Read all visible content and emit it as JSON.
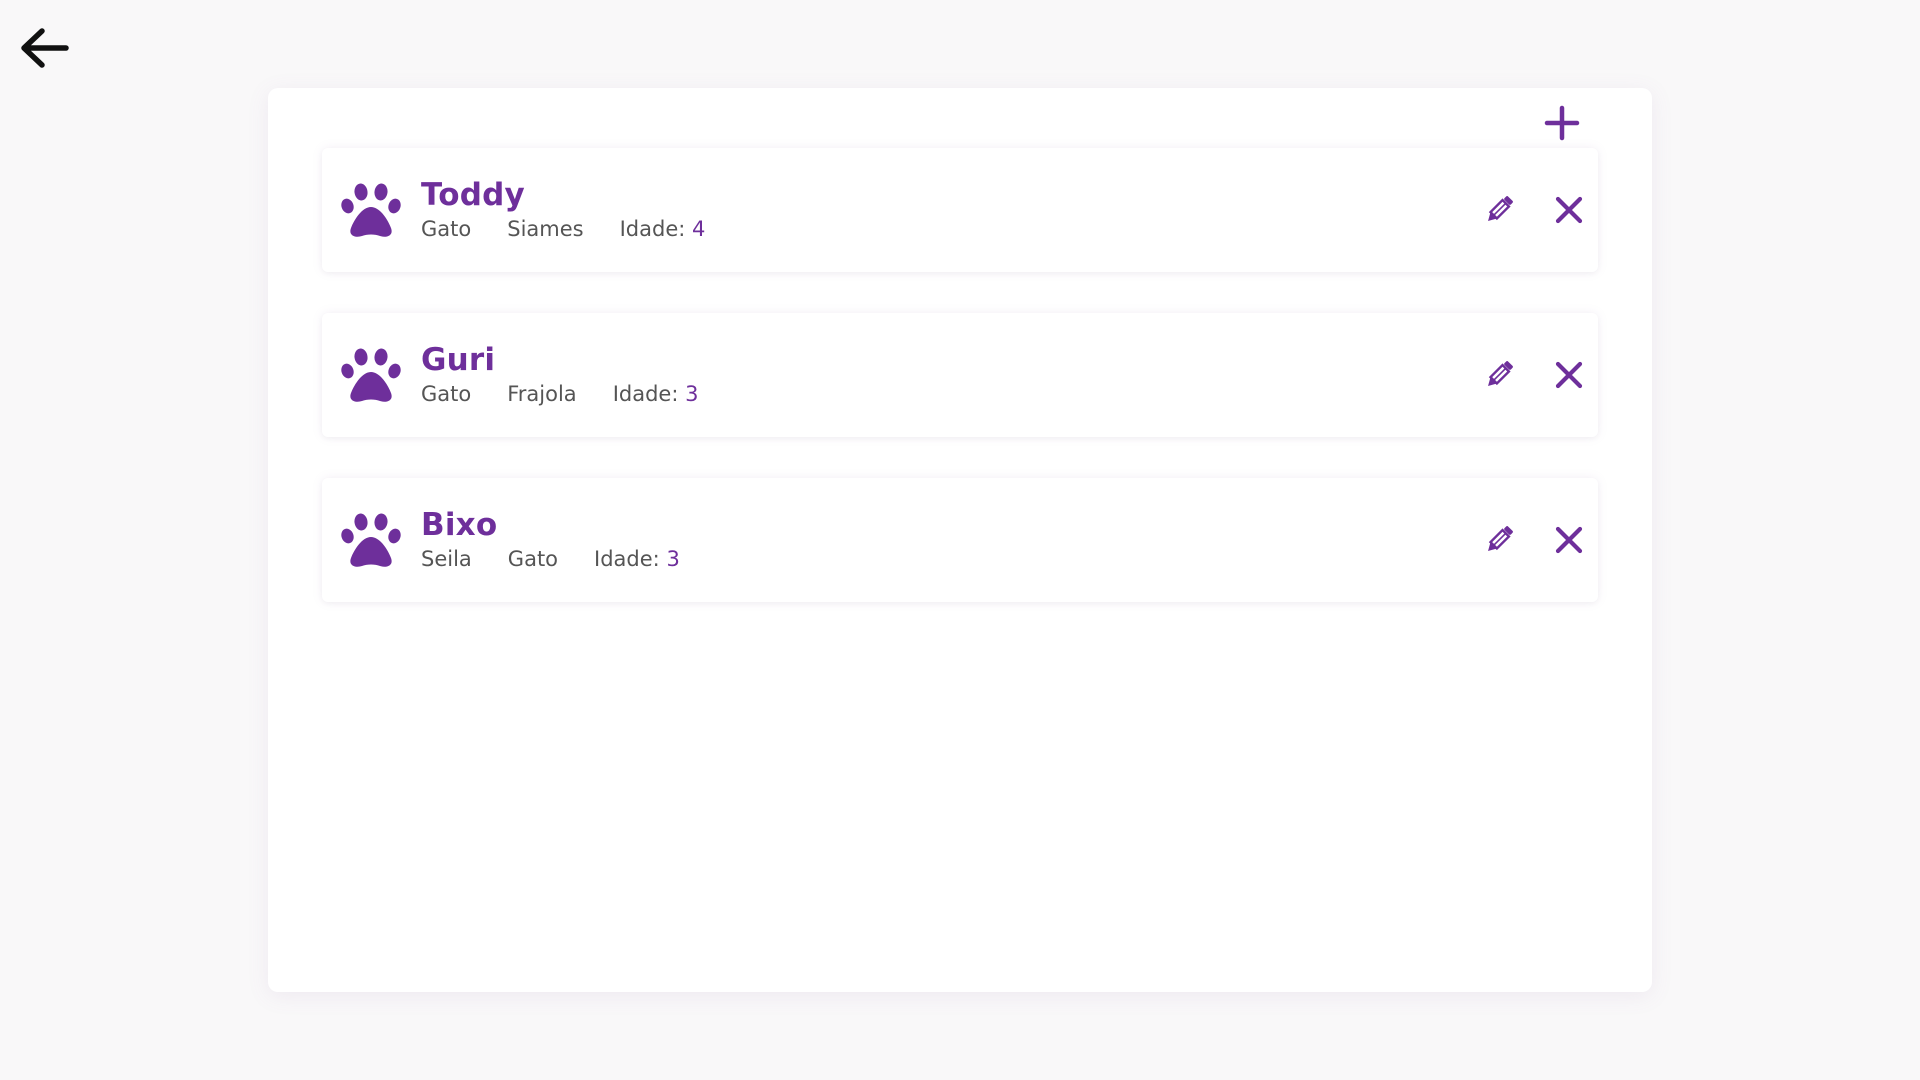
{
  "colors": {
    "accent": "#6e2f9b",
    "background": "#f9f8f9",
    "card": "#ffffff",
    "text_secondary": "#555555"
  },
  "icons": {
    "back": "arrow-left-icon",
    "add": "plus-icon",
    "pet": "paw-icon",
    "edit": "pencil-icon",
    "delete": "close-icon"
  },
  "pets": [
    {
      "name": "Toddy",
      "type": "Gato",
      "breed": "Siames",
      "age_label": "Idade:",
      "age": "4"
    },
    {
      "name": "Guri",
      "type": "Gato",
      "breed": "Frajola",
      "age_label": "Idade:",
      "age": "3"
    },
    {
      "name": "Bixo",
      "type": "Seila",
      "breed": "Gato",
      "age_label": "Idade:",
      "age": "3"
    }
  ]
}
